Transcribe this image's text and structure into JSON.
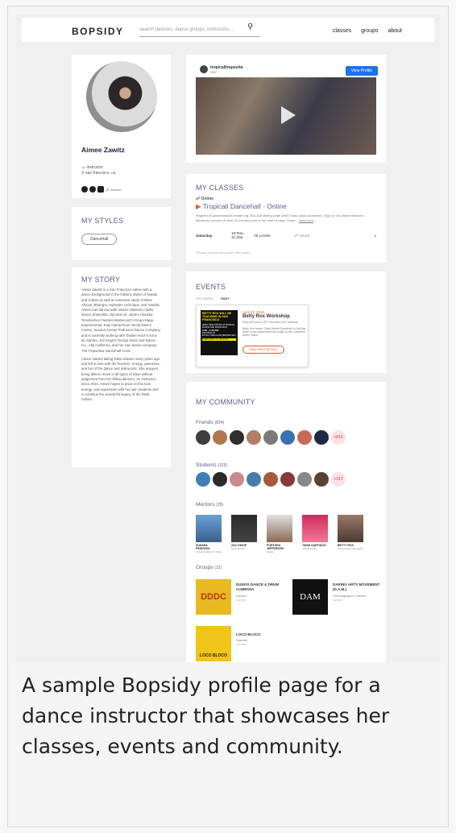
{
  "header": {
    "logo": "BOPSIDY",
    "search_placeholder": "search dancers, dance groups, instructors...",
    "nav": [
      "classes",
      "groups",
      "about"
    ]
  },
  "profile": {
    "name": "Aimee Zawitz",
    "role": "instructor",
    "location": "san francisco, ca",
    "website_label": "website"
  },
  "styles": {
    "title": "MY STYLES",
    "items": [
      "Dancehall"
    ]
  },
  "story": {
    "title": "MY STORY",
    "paragraph1": "Aimee Zawitz is a San Francisco native with a dance background in the folkloric styles of Haitian and Cuban as well as extensive study of West African, Bhangra, Sylvestre technique, and Samba. Aimee has danced with Valerie Watson's Alafia Dance Ensemble, Djenane St. Juste's Afoutayi, Teméloches Fuentes Betancourt's Grupo Nago Experimental, Katy Alania Roux' World Dance Fusion, Susana Arenas Pedroso's Dance Company, and is currently working with Tanilee Amor's Amor do Samba, Joti Singh's Duniya Drum and Dance Co., Alta California, and her own dance company, The Trapsettaz Dancehall Crew.",
    "paragraph2": "Aimee started taking R&M classes many years ago and fell in love with the freedom, energy, openness, and fun of the dance and instructors. She enjoyed being able to move in all types of ways without judgement from her fellow dancers. An instructor since 2014, Aimee hopes to pass on this love, energy, and expression with her own students and to continue the wonderful legacy of the R&M culture."
  },
  "video": {
    "account": "tropicalitrapsetta",
    "account_sub": "DDC",
    "button": "View Profile"
  },
  "classes": {
    "title": "MY CLASSES",
    "mode": "Online",
    "class_name": "Tropicali Dancehall - Online",
    "desc": "Register at dancemission-theater.org. $10-$15 sliding scale (DMT class packs accepted). Sign up via Dance Mission's Mindbody account at least 15 minutes prior to the start of class. Zoom...",
    "read_more": "view more",
    "day": "Saturday",
    "time": "10:00a - 11:30a",
    "level": "All Levels",
    "location": "virtual",
    "note": "*Please confirm schedules with studio"
  },
  "events": {
    "title": "EVENTS",
    "tabs": [
      "UPCOMING",
      "PAST"
    ],
    "flyer": {
      "headline": "BETTY ROX WILL BE TEACHING IN SAN FRANCISCO",
      "details1": "WEST SIDE STRING AT MISSION DANCE SAN FRANCISCO",
      "details2": "3:00 - 4:30 PM",
      "details3": "$15 DROP IN",
      "details4": "$17.50 1 TIME CLASS (BEFORE 3/22)",
      "details5": "THEIR FIRST CLASS IN SF"
    },
    "date": "April 22, 2019",
    "name": "Betty Rox Workshop",
    "line1": "Price $15 drop-in $17 first-time DDC students",
    "line2": "Betty Rox brings 'Goals Meets Dancehall' to the Bay Area! Learn movements and origin of the Caribbean dance styles.",
    "button": "VIEW EVENT DETAILS"
  },
  "community": {
    "title": "MY COMMUNITY",
    "friends_label": "Friends",
    "friends_count": "(824)",
    "friends_more": "+816",
    "students_label": "Students",
    "students_count": "(325)",
    "students_more": "+317",
    "mentors_label": "Mentors",
    "mentors_count": "(25)",
    "mentors": [
      {
        "name": "SUSANA PEDROSO",
        "role": "Cuban Folkloric & Salsa"
      },
      {
        "name": "ZAC DIOUF",
        "role": "West African"
      },
      {
        "name": "PORTSHA JEFFERSON",
        "role": "Haitian"
      },
      {
        "name": "TANIA SANTIAGO",
        "role": "Afro-Brazilian"
      },
      {
        "name": "BETTY ROX",
        "role": "Goals Meets Dancehall"
      }
    ],
    "groups_label": "Groups",
    "groups_count": "(12)",
    "groups": [
      {
        "name": "DUNIYA DANCE & DRUM COMPANY",
        "role": "Dancer",
        "status": "current",
        "logo": "DDDC"
      },
      {
        "name": "DARING ARTS MOVEMENT (D.A.M.)",
        "role": "Choreographer, Dancer",
        "status": "current",
        "logo": "DAM"
      },
      {
        "name": "LOCO BLOCO",
        "role": "Teacher",
        "status": "current",
        "logo": "LOCO BLOCO"
      }
    ]
  },
  "caption": "A sample Bopsidy profile page for a dance instructor that showcases her classes, events and community."
}
